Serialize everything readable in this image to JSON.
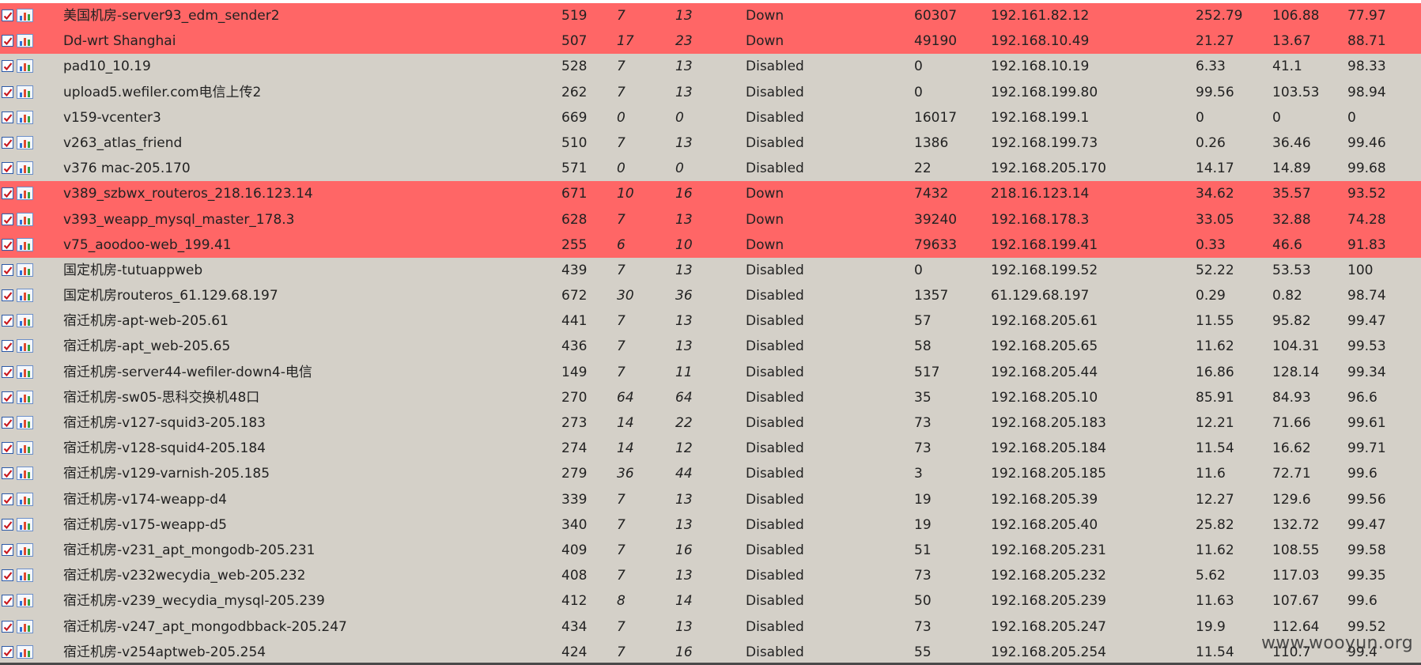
{
  "table": {
    "rows": [
      {
        "name": "美国机房-server93_edm_sender2",
        "id": "519",
        "a": "7",
        "b": "13",
        "status": "Down",
        "count": "60307",
        "ip": "192.161.82.12",
        "v1": "252.79",
        "v2": "106.88",
        "v3": "77.97",
        "down": true
      },
      {
        "name": "Dd-wrt Shanghai",
        "id": "507",
        "a": "17",
        "b": "23",
        "status": "Down",
        "count": "49190",
        "ip": "192.168.10.49",
        "v1": "21.27",
        "v2": "13.67",
        "v3": "88.71",
        "down": true
      },
      {
        "name": "pad10_10.19",
        "id": "528",
        "a": "7",
        "b": "13",
        "status": "Disabled",
        "count": "0",
        "ip": "192.168.10.19",
        "v1": "6.33",
        "v2": "41.1",
        "v3": "98.33",
        "down": false
      },
      {
        "name": "upload5.wefiler.com电信上传2",
        "id": "262",
        "a": "7",
        "b": "13",
        "status": "Disabled",
        "count": "0",
        "ip": "192.168.199.80",
        "v1": "99.56",
        "v2": "103.53",
        "v3": "98.94",
        "down": false
      },
      {
        "name": "v159-vcenter3",
        "id": "669",
        "a": "0",
        "b": "0",
        "status": "Disabled",
        "count": "16017",
        "ip": "192.168.199.1",
        "v1": "0",
        "v2": "0",
        "v3": "0",
        "down": false
      },
      {
        "name": "v263_atlas_friend",
        "id": "510",
        "a": "7",
        "b": "13",
        "status": "Disabled",
        "count": "1386",
        "ip": "192.168.199.73",
        "v1": "0.26",
        "v2": "36.46",
        "v3": "99.46",
        "down": false
      },
      {
        "name": "v376 mac-205.170",
        "id": "571",
        "a": "0",
        "b": "0",
        "status": "Disabled",
        "count": "22",
        "ip": "192.168.205.170",
        "v1": "14.17",
        "v2": "14.89",
        "v3": "99.68",
        "down": false
      },
      {
        "name": "v389_szbwx_routeros_218.16.123.14",
        "id": "671",
        "a": "10",
        "b": "16",
        "status": "Down",
        "count": "7432",
        "ip": "218.16.123.14",
        "v1": "34.62",
        "v2": "35.57",
        "v3": "93.52",
        "down": true
      },
      {
        "name": "v393_weapp_mysql_master_178.3",
        "id": "628",
        "a": "7",
        "b": "13",
        "status": "Down",
        "count": "39240",
        "ip": "192.168.178.3",
        "v1": "33.05",
        "v2": "32.88",
        "v3": "74.28",
        "down": true
      },
      {
        "name": "v75_aoodoo-web_199.41",
        "id": "255",
        "a": "6",
        "b": "10",
        "status": "Down",
        "count": "79633",
        "ip": "192.168.199.41",
        "v1": "0.33",
        "v2": "46.6",
        "v3": "91.83",
        "down": true
      },
      {
        "name": "国定机房-tutuappweb",
        "id": "439",
        "a": "7",
        "b": "13",
        "status": "Disabled",
        "count": "0",
        "ip": "192.168.199.52",
        "v1": "52.22",
        "v2": "53.53",
        "v3": "100",
        "down": false
      },
      {
        "name": "国定机房routeros_61.129.68.197",
        "id": "672",
        "a": "30",
        "b": "36",
        "status": "Disabled",
        "count": "1357",
        "ip": "61.129.68.197",
        "v1": "0.29",
        "v2": "0.82",
        "v3": "98.74",
        "down": false
      },
      {
        "name": "宿迁机房-apt-web-205.61",
        "id": "441",
        "a": "7",
        "b": "13",
        "status": "Disabled",
        "count": "57",
        "ip": "192.168.205.61",
        "v1": "11.55",
        "v2": "95.82",
        "v3": "99.47",
        "down": false
      },
      {
        "name": "宿迁机房-apt_web-205.65",
        "id": "436",
        "a": "7",
        "b": "13",
        "status": "Disabled",
        "count": "58",
        "ip": "192.168.205.65",
        "v1": "11.62",
        "v2": "104.31",
        "v3": "99.53",
        "down": false
      },
      {
        "name": "宿迁机房-server44-wefiler-down4-电信",
        "id": "149",
        "a": "7",
        "b": "11",
        "status": "Disabled",
        "count": "517",
        "ip": "192.168.205.44",
        "v1": "16.86",
        "v2": "128.14",
        "v3": "99.34",
        "down": false
      },
      {
        "name": "宿迁机房-sw05-思科交换机48口",
        "id": "270",
        "a": "64",
        "b": "64",
        "status": "Disabled",
        "count": "35",
        "ip": "192.168.205.10",
        "v1": "85.91",
        "v2": "84.93",
        "v3": "96.6",
        "down": false
      },
      {
        "name": "宿迁机房-v127-squid3-205.183",
        "id": "273",
        "a": "14",
        "b": "22",
        "status": "Disabled",
        "count": "73",
        "ip": "192.168.205.183",
        "v1": "12.21",
        "v2": "71.66",
        "v3": "99.61",
        "down": false
      },
      {
        "name": "宿迁机房-v128-squid4-205.184",
        "id": "274",
        "a": "14",
        "b": "12",
        "status": "Disabled",
        "count": "73",
        "ip": "192.168.205.184",
        "v1": "11.54",
        "v2": "16.62",
        "v3": "99.71",
        "down": false
      },
      {
        "name": "宿迁机房-v129-varnish-205.185",
        "id": "279",
        "a": "36",
        "b": "44",
        "status": "Disabled",
        "count": "3",
        "ip": "192.168.205.185",
        "v1": "11.6",
        "v2": "72.71",
        "v3": "99.6",
        "down": false
      },
      {
        "name": "宿迁机房-v174-weapp-d4",
        "id": "339",
        "a": "7",
        "b": "13",
        "status": "Disabled",
        "count": "19",
        "ip": "192.168.205.39",
        "v1": "12.27",
        "v2": "129.6",
        "v3": "99.56",
        "down": false
      },
      {
        "name": "宿迁机房-v175-weapp-d5",
        "id": "340",
        "a": "7",
        "b": "13",
        "status": "Disabled",
        "count": "19",
        "ip": "192.168.205.40",
        "v1": "25.82",
        "v2": "132.72",
        "v3": "99.47",
        "down": false
      },
      {
        "name": "宿迁机房-v231_apt_mongodb-205.231",
        "id": "409",
        "a": "7",
        "b": "16",
        "status": "Disabled",
        "count": "51",
        "ip": "192.168.205.231",
        "v1": "11.62",
        "v2": "108.55",
        "v3": "99.58",
        "down": false
      },
      {
        "name": "宿迁机房-v232wecydia_web-205.232",
        "id": "408",
        "a": "7",
        "b": "13",
        "status": "Disabled",
        "count": "73",
        "ip": "192.168.205.232",
        "v1": "5.62",
        "v2": "117.03",
        "v3": "99.35",
        "down": false
      },
      {
        "name": "宿迁机房-v239_wecydia_mysql-205.239",
        "id": "412",
        "a": "8",
        "b": "14",
        "status": "Disabled",
        "count": "50",
        "ip": "192.168.205.239",
        "v1": "11.63",
        "v2": "107.67",
        "v3": "99.6",
        "down": false
      },
      {
        "name": "宿迁机房-v247_apt_mongodbback-205.247",
        "id": "434",
        "a": "7",
        "b": "13",
        "status": "Disabled",
        "count": "73",
        "ip": "192.168.205.247",
        "v1": "19.9",
        "v2": "112.64",
        "v3": "99.52",
        "down": false
      },
      {
        "name": "宿迁机房-v254aptweb-205.254",
        "id": "424",
        "a": "7",
        "b": "16",
        "status": "Disabled",
        "count": "55",
        "ip": "192.168.205.254",
        "v1": "11.54",
        "v2": "110.7",
        "v3": "99.4",
        "down": false
      }
    ]
  },
  "watermark": "www.wooyun.org",
  "colors": {
    "down_row": "#ff6666",
    "normal_row": "#d4d0c8"
  },
  "icons": {
    "edit": "edit-checkbox-icon",
    "graph": "graph-icon"
  }
}
